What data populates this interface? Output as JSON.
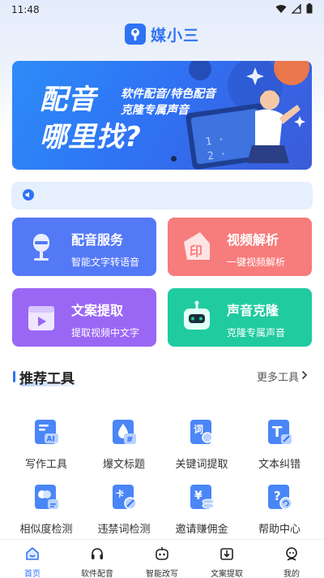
{
  "status": {
    "time": "11:48",
    "wifi_icon": "wifi-icon",
    "signal_icon": "signal-icon",
    "battery_icon": "battery-icon"
  },
  "header": {
    "app_name": "媒小三",
    "logo_icon": "wrench-shield-icon"
  },
  "banner": {
    "line1": "配音",
    "line2": "哪里找?",
    "tag1": "软件配音/特色配音",
    "tag2": "克隆专属声音"
  },
  "notice": {
    "icon": "speaker-icon",
    "text": ""
  },
  "cards": [
    {
      "title": "配音服务",
      "subtitle": "智能文字转语音",
      "color": "#5479f7",
      "icon": "microphone-icon"
    },
    {
      "title": "视频解析",
      "subtitle": "一键视频解析",
      "color": "#f77c7c",
      "icon": "stamp-icon"
    },
    {
      "title": "文案提取",
      "subtitle": "提取视频中文字",
      "color": "#9a67f5",
      "icon": "video-play-icon"
    },
    {
      "title": "声音克隆",
      "subtitle": "克隆专属声音",
      "color": "#20cba0",
      "icon": "robot-icon"
    }
  ],
  "tools_section": {
    "title": "推荐工具",
    "more": "更多工具"
  },
  "tools": [
    {
      "label": "写作工具",
      "icon": "ai-doc-icon"
    },
    {
      "label": "爆文标题",
      "icon": "hashtag-drop-icon"
    },
    {
      "label": "关键词提取",
      "icon": "search-word-icon"
    },
    {
      "label": "文本纠错",
      "icon": "text-edit-icon"
    },
    {
      "label": "相似度检测",
      "icon": "compare-icon"
    },
    {
      "label": "违禁词检测",
      "icon": "forbidden-icon"
    },
    {
      "label": "邀请赚佣金",
      "icon": "coin-icon"
    },
    {
      "label": "帮助中心",
      "icon": "help-icon"
    }
  ],
  "tabbar": [
    {
      "label": "首页",
      "icon": "home-icon",
      "active": true
    },
    {
      "label": "软件配音",
      "icon": "headset-icon",
      "active": false
    },
    {
      "label": "智能改写",
      "icon": "robot-face-icon",
      "active": false
    },
    {
      "label": "文案提取",
      "icon": "download-icon",
      "active": false
    },
    {
      "label": "我的",
      "icon": "user-icon",
      "active": false
    }
  ],
  "colors": {
    "accent": "#2f73f5",
    "tool_icon": "#4a86f7"
  }
}
